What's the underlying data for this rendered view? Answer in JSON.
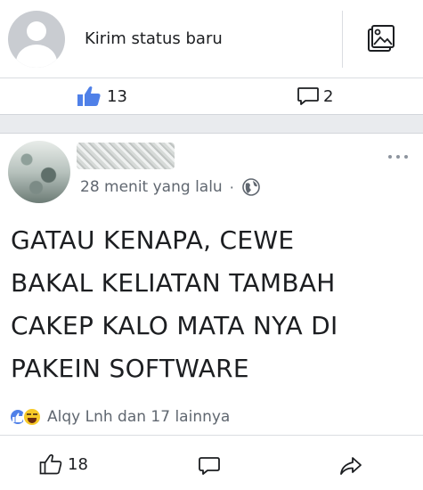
{
  "composer": {
    "status_placeholder": "Kirim status baru",
    "photo_icon": "photo-icon"
  },
  "previous_post_stats": {
    "likes": "13",
    "comments": "2"
  },
  "post": {
    "time": "28 menit yang lalu",
    "dot": "·",
    "privacy_icon": "globe-icon",
    "text_lines": [
      "GATAU KENAPA, CEWE",
      "BAKAL KELIATAN TAMBAH",
      "CAKEP KALO MATA NYA DI",
      "PAKEIN SOFTWARE"
    ],
    "reactions_text": "Alqy Lnh dan 17 lainnya",
    "like_count": "18"
  },
  "colors": {
    "like_blue": "#4f80e8",
    "text": "#1c1e21",
    "muted": "#606770"
  }
}
